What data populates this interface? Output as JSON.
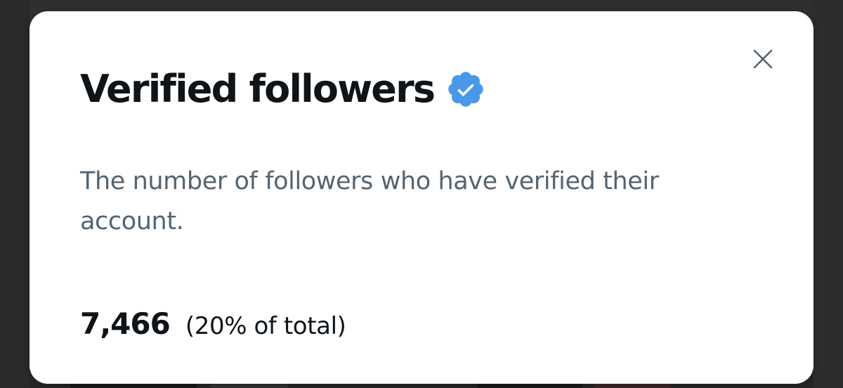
{
  "modal": {
    "title": "Verified followers",
    "badge_icon": "verified-badge-icon",
    "close_icon": "close-icon",
    "description": "The number of followers who have verified their account.",
    "stat": {
      "value": "7,466",
      "share": "(20% of total)"
    }
  },
  "colors": {
    "badge": "#4a99e9",
    "title_text": "#0f1419",
    "secondary_text": "#536471",
    "close_icon": "#536471",
    "modal_background": "#ffffff",
    "backdrop": "#2b2b2b"
  }
}
